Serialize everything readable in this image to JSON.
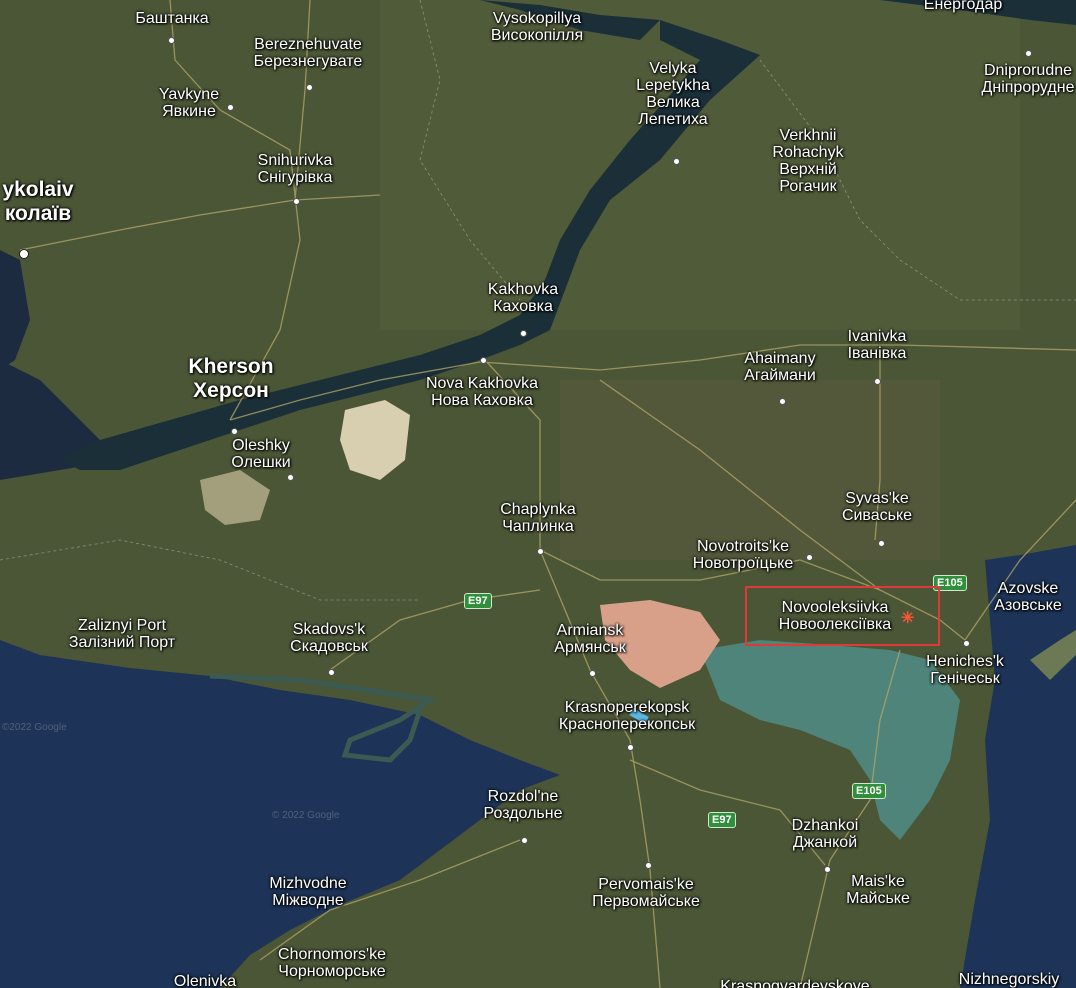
{
  "map": {
    "labels": {
      "bashtanka": {
        "en": "",
        "uk": "Баштанка"
      },
      "vysokopillya": {
        "en": "Vysokopillya",
        "uk": "Високопілля"
      },
      "energodar": {
        "en": "",
        "uk": "Енергодар"
      },
      "bereznehuvate": {
        "en": "Bereznehuvate",
        "uk": "Березнегувате"
      },
      "yavkyne": {
        "en": "Yavkyne",
        "uk": "Явкине"
      },
      "velyka_lepetykha": {
        "en": "Velyka Lepetykha",
        "uk": "Велика Лепетиха"
      },
      "dniprorudne": {
        "en": "Dniprorudne",
        "uk": "Дніпрорудне"
      },
      "verkhnii_rohachyk": {
        "en": "Verkhnii Rohachyk",
        "uk": "Верхній Рогачик"
      },
      "snihurivka": {
        "en": "Snihurivka",
        "uk": "Снігурівка"
      },
      "mykolaiv": {
        "en": "ykolaiv",
        "uk": "колаїв"
      },
      "kakhovka": {
        "en": "Kakhovka",
        "uk": "Каховка"
      },
      "ivanivka": {
        "en": "Ivanivka",
        "uk": "Іванівка"
      },
      "kherson": {
        "en": "Kherson",
        "uk": "Херсон"
      },
      "nova_kakhovka": {
        "en": "Nova Kakhovka",
        "uk": "Нова Каховка"
      },
      "ahaimany": {
        "en": "Ahaimany",
        "uk": "Агаймани"
      },
      "oleshky": {
        "en": "Oleshky",
        "uk": "Олешки"
      },
      "chaplynka": {
        "en": "Chaplynka",
        "uk": "Чаплинка"
      },
      "syvaske": {
        "en": "Syvas'ke",
        "uk": "Сиваське"
      },
      "novotroitske": {
        "en": "Novotroits'ke",
        "uk": "Новотроїцьке"
      },
      "azovske": {
        "en": "Azovske",
        "uk": "Азовське"
      },
      "zaliznyi_port": {
        "en": "Zaliznyi Port",
        "uk": "Залізний Порт"
      },
      "skadovsk": {
        "en": "Skadovs'k",
        "uk": "Скадовськ"
      },
      "armiansk": {
        "en": "Armiansk",
        "uk": "Армянськ"
      },
      "novooleksiivka": {
        "en": "Novooleksiivka",
        "uk": "Новоолексіївка"
      },
      "henichesk": {
        "en": "Heniches'k",
        "uk": "Генічеськ"
      },
      "krasnoperekopsk": {
        "en": "Krasnoperekopsk",
        "uk": "Красноперекопськ"
      },
      "rozdolne": {
        "en": "Rozdol'ne",
        "uk": "Роздольне"
      },
      "dzhankoi": {
        "en": "Dzhankoi",
        "uk": "Джанкой"
      },
      "mizhvodne": {
        "en": "Mizhvodne",
        "uk": "Міжводне"
      },
      "pervomaiske": {
        "en": "Pervomais'ke",
        "uk": "Первомайське"
      },
      "maiske": {
        "en": "Mais'ke",
        "uk": "Майське"
      },
      "chornomorske": {
        "en": "Chornomors'ke",
        "uk": "Чорноморське"
      },
      "olenivka": {
        "en": "Olenivka",
        "uk": ""
      },
      "krasnohvardiiske": {
        "en": "Krasnogvardeyskoye",
        "uk": ""
      },
      "nizhnegorskiy": {
        "en": "Nizhnegorskiy",
        "uk": ""
      }
    },
    "road_shields": {
      "e105_a": "E105",
      "e97_a": "E97",
      "e105_b": "E105",
      "e97_b": "E97"
    },
    "watermarks": {
      "a": "©2022 Google",
      "b": "© 2022 Google"
    },
    "colors": {
      "land": "#4a5636",
      "sea": "#1d3357",
      "river": "#1a2f38",
      "lagoon": "#4f8c86",
      "salt_lake": "#d9a089",
      "highlight": "#e0393a",
      "road_shield": "#2f8f3a"
    }
  }
}
